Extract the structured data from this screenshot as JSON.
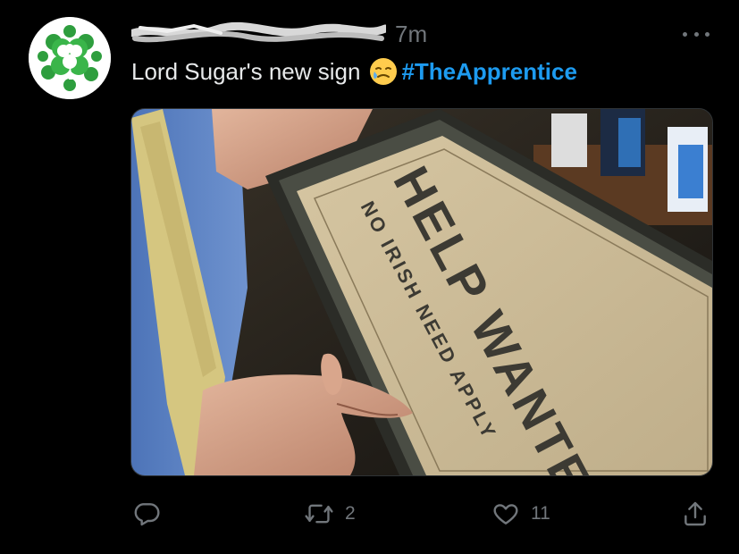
{
  "tweet": {
    "timestamp": "7m",
    "text": "Lord Sugar's new sign",
    "hashtag": "#TheApprentice",
    "emoji": "face-with-tear-emoji"
  },
  "media": {
    "sign_title": "HELP WANTED",
    "sign_subtitle": "NO IRISH NEED APPLY"
  },
  "actions": {
    "reply_count": "",
    "retweet_count": "2",
    "like_count": "11"
  },
  "colors": {
    "background": "#000000",
    "text": "#e7e9ea",
    "muted": "#71767b",
    "hashtag": "#1d9bf0",
    "shamrock": "#2e9e3e"
  },
  "icons": [
    "shamrock-avatar",
    "more-icon",
    "reply-icon",
    "retweet-icon",
    "like-icon",
    "share-icon"
  ]
}
